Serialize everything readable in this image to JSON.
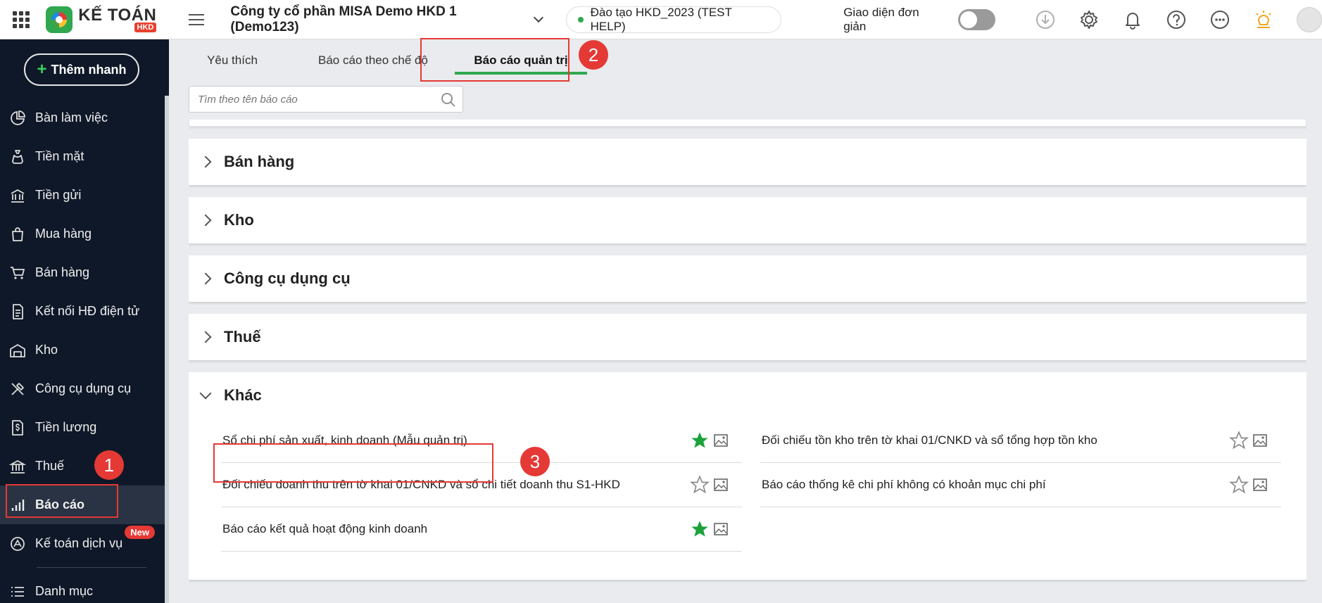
{
  "header": {
    "logo_title": "KẾ TOÁN",
    "logo_badge": "HKD",
    "company": "Công ty cổ phần MISA Demo HKD 1 (Demo123)",
    "database": "Đào tạo HKD_2023 (TEST HELP)",
    "simple_ui_label": "Giao diện đơn giản"
  },
  "sidebar": {
    "quick_add": "Thêm nhanh",
    "items": [
      {
        "label": "Bàn làm việc",
        "icon": "dashboard-icon"
      },
      {
        "label": "Tiền mặt",
        "icon": "money-bag-icon"
      },
      {
        "label": "Tiền gửi",
        "icon": "bank-icon"
      },
      {
        "label": "Mua hàng",
        "icon": "shopping-bag-icon"
      },
      {
        "label": "Bán hàng",
        "icon": "cart-icon"
      },
      {
        "label": "Kết nối HĐ điện tử",
        "icon": "invoice-icon"
      },
      {
        "label": "Kho",
        "icon": "warehouse-icon"
      },
      {
        "label": "Công cụ dụng cụ",
        "icon": "tools-icon"
      },
      {
        "label": "Tiền lương",
        "icon": "salary-icon"
      },
      {
        "label": "Thuế",
        "icon": "tax-icon"
      },
      {
        "label": "Báo cáo",
        "icon": "report-chart-icon",
        "active": true
      },
      {
        "label": "Kế toán dịch vụ",
        "icon": "service-icon",
        "badge": "New"
      },
      {
        "label": "Danh mục",
        "icon": "list-icon"
      }
    ]
  },
  "tabs": [
    "Yêu thích",
    "Báo cáo theo chế độ",
    "Báo cáo quản trị"
  ],
  "search": {
    "placeholder": "Tìm theo tên báo cáo"
  },
  "groups": [
    {
      "title": "Bán hàng",
      "expanded": false
    },
    {
      "title": "Kho",
      "expanded": false
    },
    {
      "title": "Công cụ dụng cụ",
      "expanded": false
    },
    {
      "title": "Thuế",
      "expanded": false
    },
    {
      "title": "Khác",
      "expanded": true
    }
  ],
  "reports": [
    {
      "label": "Sổ chi phí sản xuất, kinh doanh (Mẫu quản trị)",
      "favorite": true
    },
    {
      "label": "Đối chiếu tồn kho trên tờ khai 01/CNKD và sổ tổng hợp tồn kho",
      "favorite": false
    },
    {
      "label": "Đối chiếu doanh thu trên tờ khai 01/CNKD và sổ chi tiết doanh thu S1-HKD",
      "favorite": false
    },
    {
      "label": "Báo cáo thống kê chi phí không có khoản mục chi phí",
      "favorite": false
    },
    {
      "label": "Báo cáo kết quả hoạt động kinh doanh",
      "favorite": true
    }
  ],
  "annotations": [
    "1",
    "2",
    "3"
  ],
  "colors": {
    "accent_green": "#2fa84f",
    "sidebar_bg": "#0f1828",
    "highlight_red": "#e53935",
    "star_filled": "#1aa23a"
  }
}
